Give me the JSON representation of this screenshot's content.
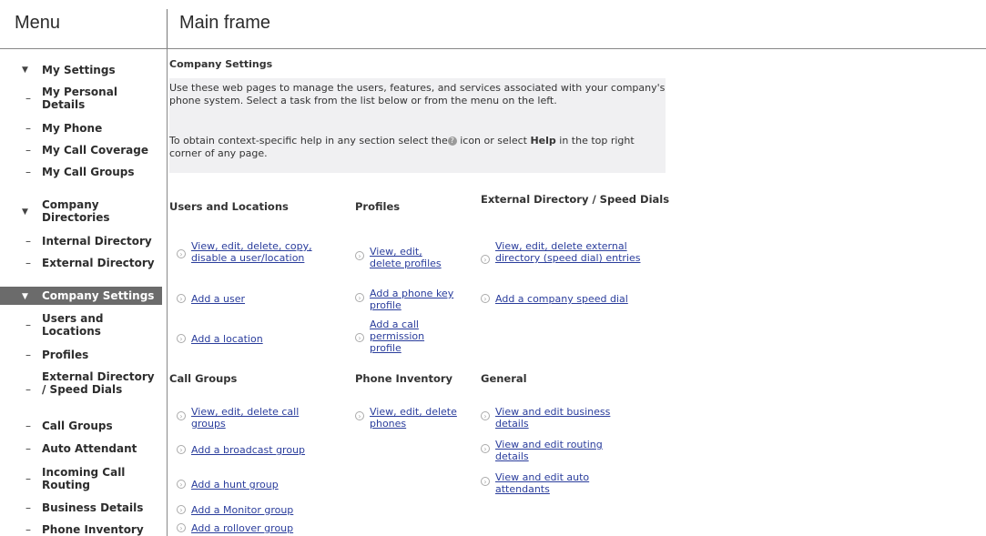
{
  "header": {
    "menu_title": "Menu",
    "main_title": "Main frame"
  },
  "menu": {
    "my_settings": "My Settings",
    "my_personal_details": "My Personal Details",
    "my_phone": "My Phone",
    "my_call_coverage": "My Call Coverage",
    "my_call_groups": "My Call Groups",
    "company_directories": "Company Directories",
    "internal_directory": "Internal Directory",
    "external_directory": "External Directory",
    "company_settings": "Company Settings",
    "users_and_locations": "Users and Locations",
    "profiles": "Profiles",
    "external_directory_speed_dials": "External Directory / Speed Dials",
    "call_groups": "Call Groups",
    "auto_attendant": "Auto Attendant",
    "incoming_call_routing": "Incoming Call Routing",
    "business_details": "Business Details",
    "phone_inventory": "Phone Inventory"
  },
  "main": {
    "title": "Company Settings",
    "intro_1": "Use these web pages to manage the users, features, and services associated with your company's phone system. Select a task from the list below or from the menu on the left.",
    "intro_2a": "To obtain context-specific help in any section select the",
    "intro_2b": " icon or select ",
    "intro_2c": "Help",
    "intro_2d": " in the top right corner of any page.",
    "col_users": "Users and Locations",
    "col_profiles": "Profiles",
    "col_external": "External Directory / Speed Dials",
    "col_call_groups": "Call Groups",
    "col_phone_inventory": "Phone Inventory",
    "col_general": "General",
    "link_view_users": "View, edit, delete, copy, disable a user/location",
    "link_add_user": "Add a user",
    "link_add_location": "Add a location",
    "link_view_profiles": "View, edit, delete profiles",
    "link_add_phone_key": "Add a phone key profile",
    "link_add_call_permission": "Add a call permission profile",
    "link_view_external": "View, edit, delete external directory (speed dial) entries",
    "link_add_speed_dial": "Add a company speed dial",
    "link_view_call_groups": "View, edit, delete call groups",
    "link_add_broadcast": "Add a broadcast group",
    "link_add_hunt": "Add a hunt group",
    "link_add_monitor": "Add a Monitor group",
    "link_add_rollover": "Add a rollover group",
    "link_view_phones": "View, edit, delete phones",
    "link_business_details": "View and edit business details",
    "link_routing_details": "View and edit routing details",
    "link_auto_attendants": "View and edit auto attendants"
  }
}
